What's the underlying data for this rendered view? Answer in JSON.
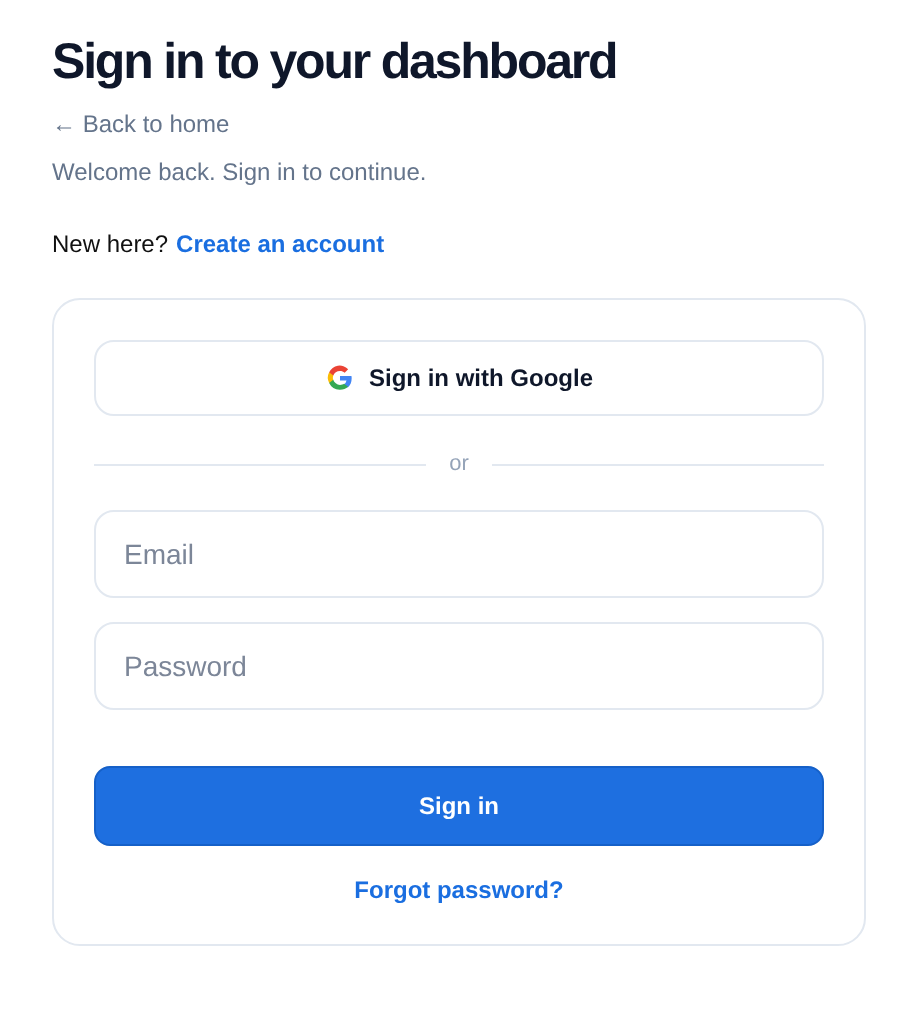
{
  "title": "Sign in to your dashboard",
  "back_link": "← Back to home",
  "subtitle": "Welcome back. Sign in to continue.",
  "signup_prompt": {
    "text": "New here?",
    "link": "Create an account"
  },
  "card": {
    "google_button": "Sign in with Google",
    "divider": "or",
    "fields": [
      {
        "placeholder": "Email"
      },
      {
        "placeholder": "Password"
      }
    ],
    "submit_button": "Sign in",
    "forgot_link": "Forgot password?"
  }
}
